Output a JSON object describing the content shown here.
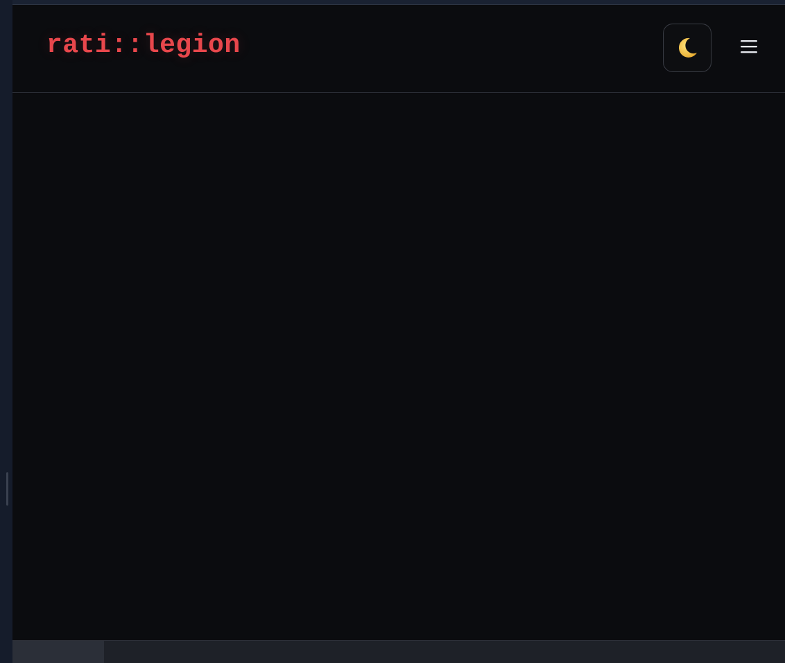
{
  "brand": {
    "name": "rati::legion",
    "color": "#e8474c"
  },
  "header": {
    "theme_toggle_icon": "moon-icon",
    "menu_icon": "hamburger-menu-icon"
  },
  "bottom_bar": {
    "tabs": [
      {
        "label": "",
        "active": true
      },
      {
        "label": "",
        "active": false
      },
      {
        "label": "",
        "active": false
      },
      {
        "label": "",
        "active": false
      },
      {
        "label": "",
        "active": false
      }
    ]
  },
  "colors": {
    "background": "#0b0c0f",
    "accent": "#e8474c",
    "moon": "#f3c74a"
  }
}
